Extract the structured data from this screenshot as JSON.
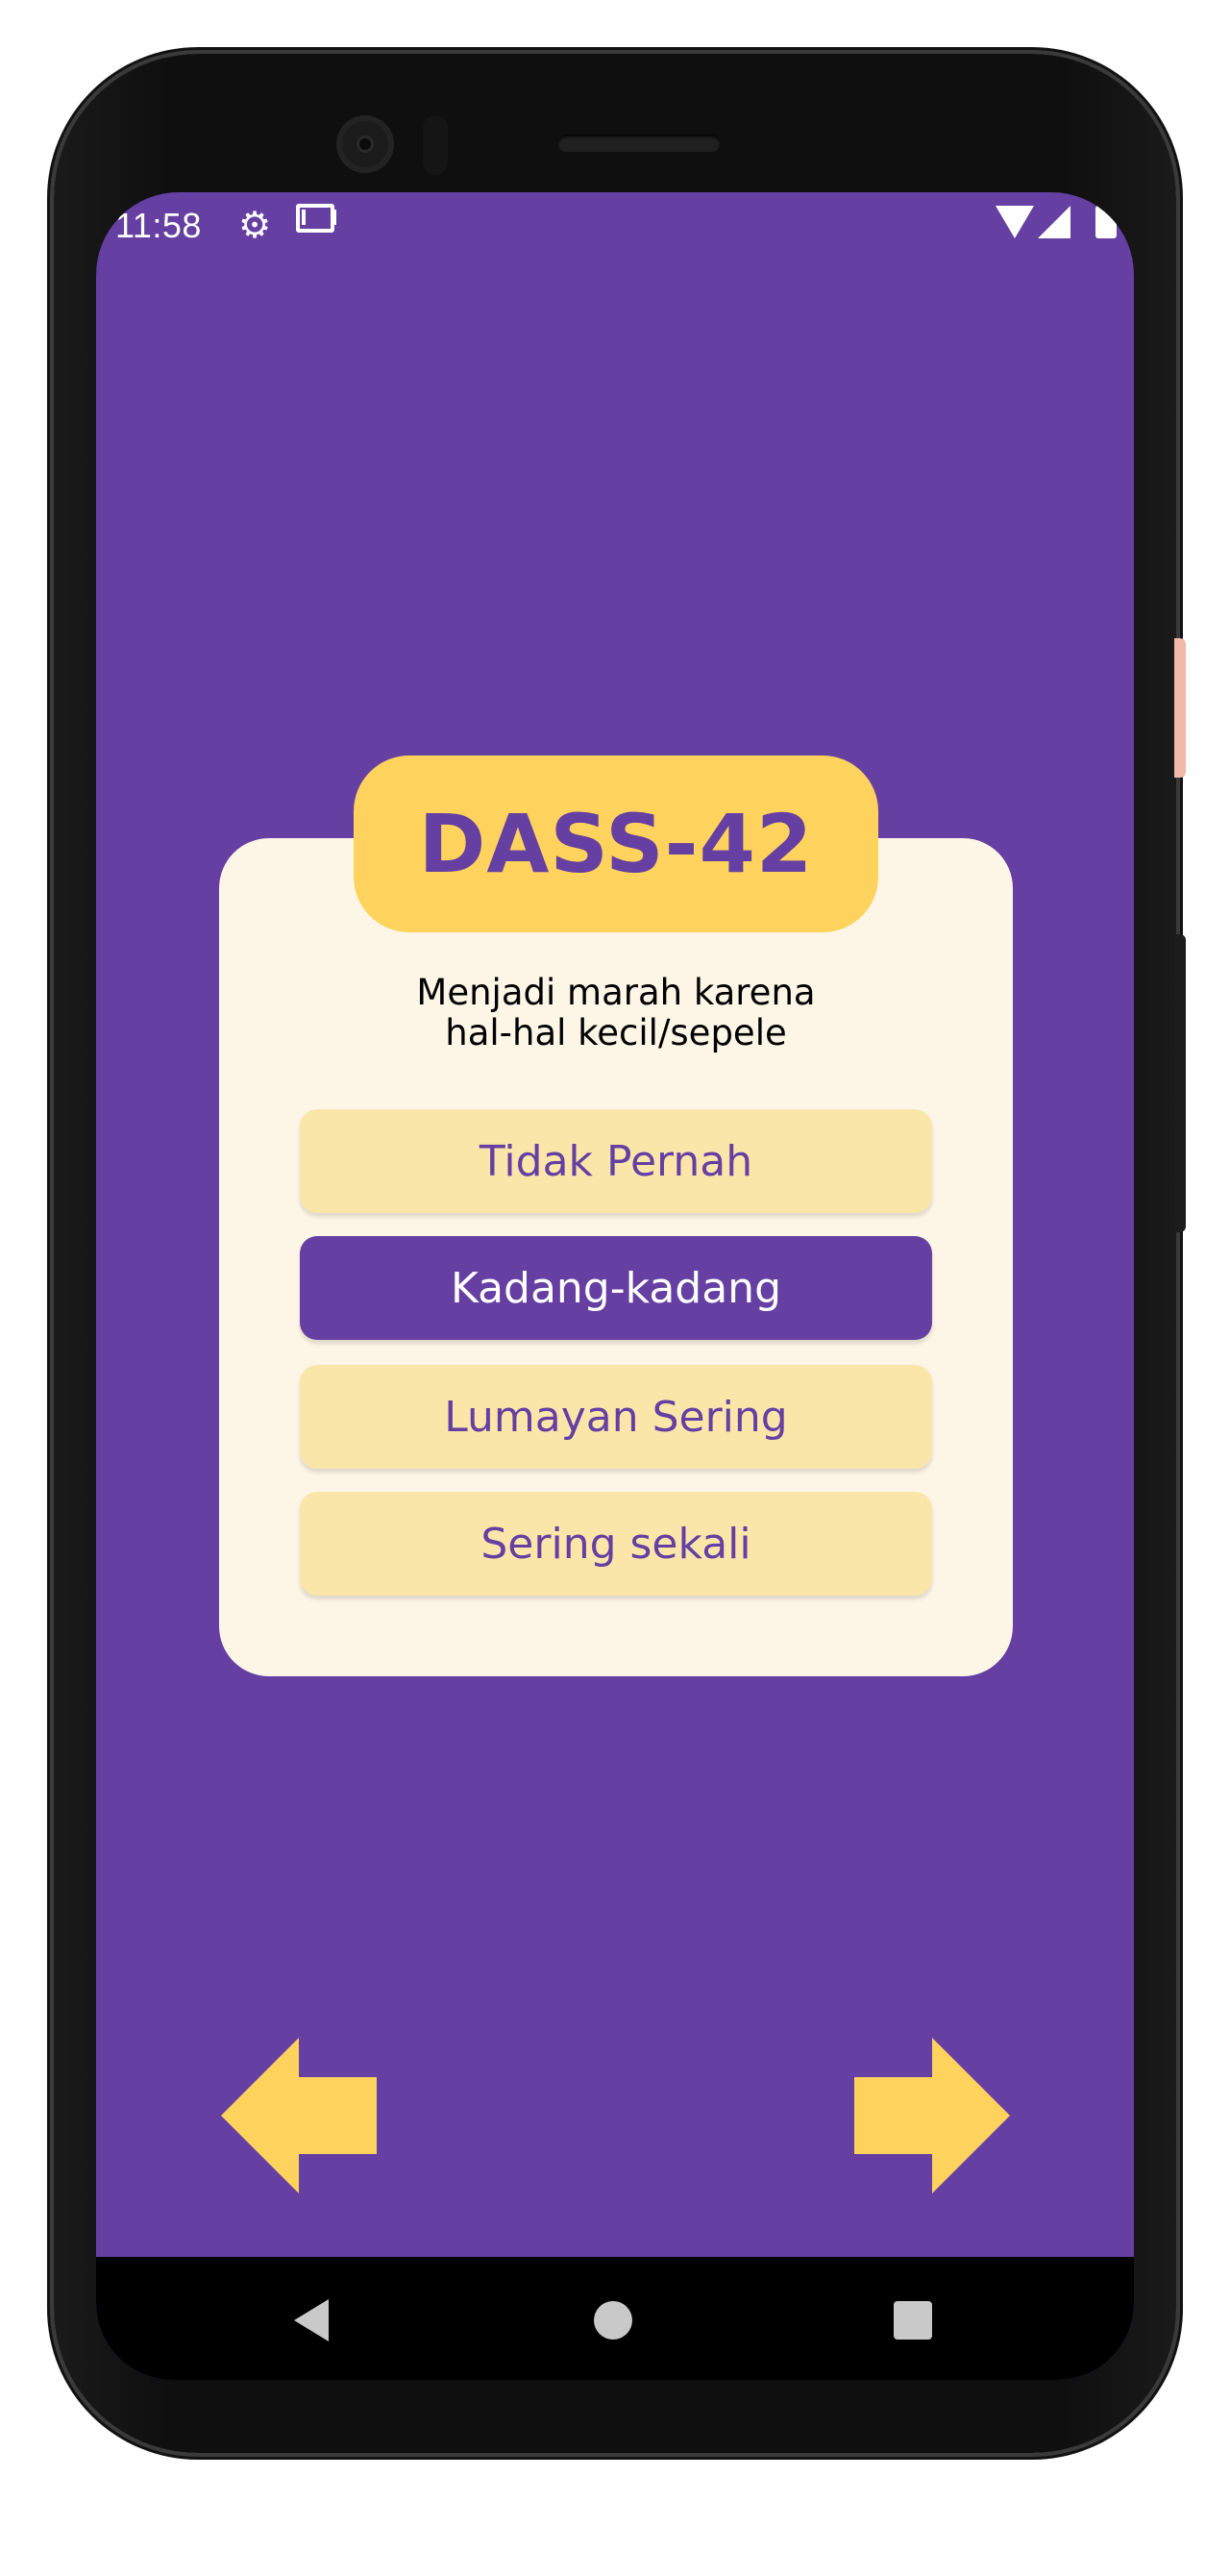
{
  "status_bar": {
    "time": "11:58",
    "icons": [
      "gear-icon",
      "gmail-icon",
      "wifi-icon",
      "cell-signal-icon",
      "battery-icon"
    ]
  },
  "quiz": {
    "title": "DASS-42",
    "question_line1": "Menjadi marah karena",
    "question_line2": "hal-hal kecil/sepele",
    "options": [
      {
        "label": "Tidak Pernah",
        "selected": false
      },
      {
        "label": "Kadang-kadang",
        "selected": true
      },
      {
        "label": "Lumayan Sering",
        "selected": false
      },
      {
        "label": "Sering sekali",
        "selected": false
      }
    ]
  },
  "navigation": {
    "prev_icon": "arrow-left-icon",
    "next_icon": "arrow-right-icon"
  },
  "system_nav": [
    "back-icon",
    "home-icon",
    "recents-icon"
  ],
  "colors": {
    "background": "#653fa1",
    "card": "#fdf6e7",
    "accent_yellow": "#fdd25d",
    "option_unselected": "#fbe6aa",
    "option_selected": "#653fa1"
  }
}
